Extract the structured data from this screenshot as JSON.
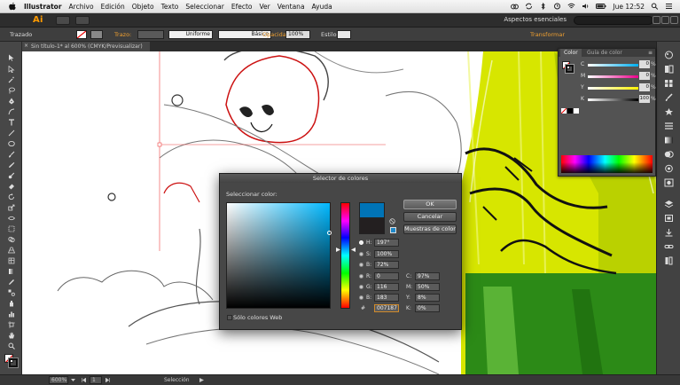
{
  "menubar": {
    "app": "Illustrator",
    "items": [
      "Archivo",
      "Edición",
      "Objeto",
      "Texto",
      "Seleccionar",
      "Efecto",
      "Ver",
      "Ventana",
      "Ayuda"
    ],
    "clock": "Jue 12:52"
  },
  "appbar": {
    "logo": "Ai",
    "workspace": "Aspectos esenciales"
  },
  "controlbar": {
    "mode": "Trazado",
    "stroke_label": "Trazo:",
    "uniform": "Uniforme",
    "basic": "Básico",
    "opacity_label": "Opacidad:",
    "opacity": "100%",
    "style_label": "Estilo:",
    "transform": "Transformar"
  },
  "document": {
    "tab": "Sin título-1* al 600% (CMYK/Previsualizar)"
  },
  "color_panel": {
    "tab_color": "Color",
    "tab_guide": "Guía de color",
    "channels": [
      {
        "key": "C",
        "value": "0",
        "unit": "%"
      },
      {
        "key": "M",
        "value": "0",
        "unit": "%"
      },
      {
        "key": "Y",
        "value": "0",
        "unit": "%"
      },
      {
        "key": "K",
        "value": "100",
        "unit": "%"
      }
    ]
  },
  "picker": {
    "title": "Selector de colores",
    "select_label": "Seleccionar color:",
    "ok": "OK",
    "cancel": "Cancelar",
    "swatches": "Muestras de color",
    "hsb": [
      {
        "key": "H:",
        "value": "197°"
      },
      {
        "key": "S:",
        "value": "100%"
      },
      {
        "key": "B:",
        "value": "72%"
      }
    ],
    "rgb": [
      {
        "key": "R:",
        "value": "0"
      },
      {
        "key": "G:",
        "value": "116"
      },
      {
        "key": "B:",
        "value": "183"
      }
    ],
    "cmyk": [
      {
        "key": "C:",
        "value": "97%"
      },
      {
        "key": "M:",
        "value": "50%"
      },
      {
        "key": "Y:",
        "value": "8%"
      },
      {
        "key": "K:",
        "value": "0%"
      }
    ],
    "hex_key": "#",
    "hex": "007187",
    "web_only": "Sólo colores Web",
    "new_color": "#0074b7",
    "old_color": "#231f20"
  },
  "status": {
    "zoom": "600%",
    "page": "1",
    "tool": "Selección"
  }
}
